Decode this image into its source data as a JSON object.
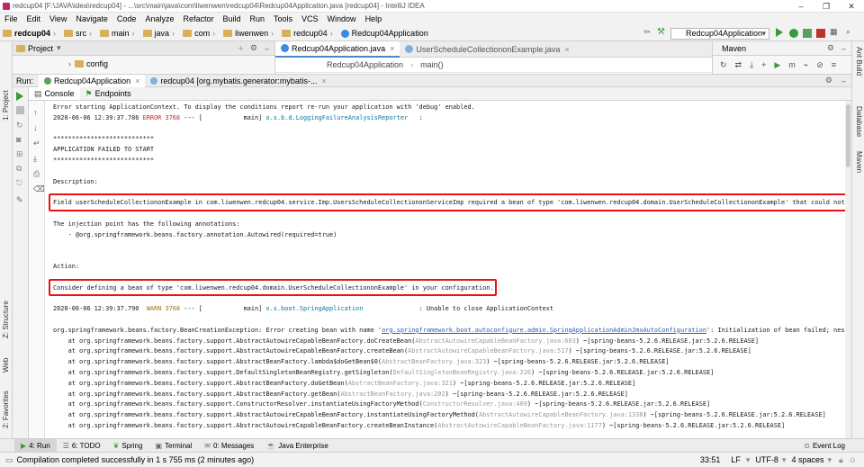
{
  "window": {
    "title": "redcup04 [F:\\JAVA\\idea\\redcup04] - ...\\src\\main\\java\\com\\liwenwen\\redcup04\\Redcup04Application.java [redcup04] - IntelliJ IDEA",
    "controls": [
      "–",
      "❐",
      "✕"
    ]
  },
  "menu": [
    "File",
    "Edit",
    "View",
    "Navigate",
    "Code",
    "Analyze",
    "Refactor",
    "Build",
    "Run",
    "Tools",
    "VCS",
    "Window",
    "Help"
  ],
  "breadcrumb": [
    "redcup04",
    "src",
    "main",
    "java",
    "com",
    "liwenwen",
    "redcup04",
    "Redcup04Application"
  ],
  "run_config": "Redcup04Application",
  "project_panel": {
    "title": "Project",
    "item": "config"
  },
  "editor_tabs": [
    {
      "label": "Redcup04Application.java",
      "active": true
    },
    {
      "label": "UserScheduleCollectiononExample.java",
      "active": false
    }
  ],
  "editor_crumbs": [
    "Redcup04Application",
    "main()"
  ],
  "maven": {
    "title": "Maven"
  },
  "run_panel": {
    "label": "Run:",
    "tabs": [
      "Redcup04Application",
      "redcup04 [org.mybatis.generator:mybatis-..."
    ],
    "subtabs": [
      "Console",
      "Endpoints"
    ]
  },
  "console_lines": [
    {
      "segs": [
        {
          "t": "Error starting ApplicationContext. To display the conditions report re-run your application with 'debug' enabled.",
          "c": ""
        }
      ]
    },
    {
      "segs": [
        {
          "t": "2020-06-06 12:39:37.786 ",
          "c": ""
        },
        {
          "t": "ERROR 3768",
          "c": "err"
        },
        {
          "t": " --- [           main] ",
          "c": ""
        },
        {
          "t": "o.s.b.d.LoggingFailureAnalysisReporter",
          "c": "cls"
        },
        {
          "t": "   :",
          "c": ""
        }
      ]
    },
    {
      "segs": [
        {
          "t": "",
          "c": ""
        }
      ]
    },
    {
      "segs": [
        {
          "t": "***************************",
          "c": ""
        }
      ]
    },
    {
      "segs": [
        {
          "t": "APPLICATION FAILED TO START",
          "c": ""
        }
      ]
    },
    {
      "segs": [
        {
          "t": "***************************",
          "c": ""
        }
      ]
    },
    {
      "segs": [
        {
          "t": "",
          "c": ""
        }
      ]
    },
    {
      "segs": [
        {
          "t": "Description:",
          "c": ""
        }
      ]
    },
    {
      "segs": [
        {
          "t": "",
          "c": ""
        }
      ]
    },
    {
      "segs": [
        {
          "t": "Field userScheduleCollectiononExample in com.liwenwen.redcup04.service.Imp.UsersScheduleCollectiononServiceImp required a bean of type 'com.liwenwen.redcup04.domain.UserScheduleCollectiononExample' that could not be found.",
          "c": ""
        }
      ]
    },
    {
      "segs": [
        {
          "t": "",
          "c": ""
        }
      ]
    },
    {
      "segs": [
        {
          "t": "The injection point has the following annotations:",
          "c": ""
        }
      ]
    },
    {
      "segs": [
        {
          "t": "    - @org.springframework.beans.factory.annotation.Autowired(required=true)",
          "c": ""
        }
      ]
    },
    {
      "segs": [
        {
          "t": "",
          "c": ""
        }
      ]
    },
    {
      "segs": [
        {
          "t": "",
          "c": ""
        }
      ]
    },
    {
      "segs": [
        {
          "t": "Action:",
          "c": ""
        }
      ]
    },
    {
      "segs": [
        {
          "t": "",
          "c": ""
        }
      ]
    },
    {
      "segs": [
        {
          "t": "Consider defining a bean of type 'com.liwenwen.redcup04.domain.UserScheduleCollectiononExample' in your configuration.",
          "c": ""
        }
      ]
    },
    {
      "segs": [
        {
          "t": "",
          "c": ""
        }
      ]
    },
    {
      "segs": [
        {
          "t": "2020-06-06 12:39:37.790  ",
          "c": ""
        },
        {
          "t": "WARN 3768",
          "c": "warn"
        },
        {
          "t": " --- [           main] ",
          "c": ""
        },
        {
          "t": "o.s.boot.SpringApplication",
          "c": "cls"
        },
        {
          "t": "               : Unable to close ApplicationContext",
          "c": ""
        }
      ]
    },
    {
      "segs": [
        {
          "t": "",
          "c": ""
        }
      ]
    },
    {
      "segs": [
        {
          "t": "org.springframework.beans.factory.BeanCreationException: Error creating bean with name '",
          "c": ""
        },
        {
          "t": "org.springframework.boot.autoconfigure.admin.SpringApplicationAdminJmxAutoConfiguration",
          "c": "lnk"
        },
        {
          "t": "': Initialization of bean failed; nested exception",
          "c": ""
        }
      ]
    },
    {
      "segs": [
        {
          "t": "    at org.springframework.beans.factory.support.AbstractAutowireCapableBeanFactory.doCreateBean(",
          "c": ""
        },
        {
          "t": "AbstractAutowireCapableBeanFactory.java:603",
          "c": "gray"
        },
        {
          "t": ") ~[spring-beans-5.2.6.RELEASE.jar:5.2.6.RELEASE]",
          "c": ""
        }
      ]
    },
    {
      "segs": [
        {
          "t": "    at org.springframework.beans.factory.support.AbstractAutowireCapableBeanFactory.createBean(",
          "c": ""
        },
        {
          "t": "AbstractAutowireCapableBeanFactory.java:517",
          "c": "gray"
        },
        {
          "t": ") ~[spring-beans-5.2.6.RELEASE.jar:5.2.6.RELEASE]",
          "c": ""
        }
      ]
    },
    {
      "segs": [
        {
          "t": "    at org.springframework.beans.factory.support.AbstractBeanFactory.lambda$doGetBean$0(",
          "c": ""
        },
        {
          "t": "AbstractBeanFactory.java:323",
          "c": "gray"
        },
        {
          "t": ") ~[spring-beans-5.2.6.RELEASE.jar:5.2.6.RELEASE]",
          "c": ""
        }
      ]
    },
    {
      "segs": [
        {
          "t": "    at org.springframework.beans.factory.support.DefaultSingletonBeanRegistry.getSingleton(",
          "c": ""
        },
        {
          "t": "DefaultSingletonBeanRegistry.java:226",
          "c": "gray"
        },
        {
          "t": ") ~[spring-beans-5.2.6.RELEASE.jar:5.2.6.RELEASE]",
          "c": ""
        }
      ]
    },
    {
      "segs": [
        {
          "t": "    at org.springframework.beans.factory.support.AbstractBeanFactory.doGetBean(",
          "c": ""
        },
        {
          "t": "AbstractBeanFactory.java:321",
          "c": "gray"
        },
        {
          "t": ") ~[spring-beans-5.2.6.RELEASE.jar:5.2.6.RELEASE]",
          "c": ""
        }
      ]
    },
    {
      "segs": [
        {
          "t": "    at org.springframework.beans.factory.support.AbstractBeanFactory.getBean(",
          "c": ""
        },
        {
          "t": "AbstractBeanFactory.java:202",
          "c": "gray"
        },
        {
          "t": ") ~[spring-beans-5.2.6.RELEASE.jar:5.2.6.RELEASE]",
          "c": ""
        }
      ]
    },
    {
      "segs": [
        {
          "t": "    at org.springframework.beans.factory.support.ConstructorResolver.instantiateUsingFactoryMethod(",
          "c": ""
        },
        {
          "t": "ConstructorResolver.java:409",
          "c": "gray"
        },
        {
          "t": ") ~[spring-beans-5.2.6.RELEASE.jar:5.2.6.RELEASE]",
          "c": ""
        }
      ]
    },
    {
      "segs": [
        {
          "t": "    at org.springframework.beans.factory.support.AbstractAutowireCapableBeanFactory.instantiateUsingFactoryMethod(",
          "c": ""
        },
        {
          "t": "AbstractAutowireCapableBeanFactory.java:1338",
          "c": "gray"
        },
        {
          "t": ") ~[spring-beans-5.2.6.RELEASE.jar:5.2.6.RELEASE]",
          "c": ""
        }
      ]
    },
    {
      "segs": [
        {
          "t": "    at org.springframework.beans.factory.support.AbstractAutowireCapableBeanFactory.createBeanInstance(",
          "c": ""
        },
        {
          "t": "AbstractAutowireCapableBeanFactory.java:1177",
          "c": "gray"
        },
        {
          "t": ") ~[spring-beans-5.2.6.RELEASE.jar:5.2.6.RELEASE]",
          "c": ""
        }
      ]
    }
  ],
  "bottom_tabs": [
    {
      "label": "4: Run",
      "active": true
    },
    {
      "label": "6: TODO",
      "active": false
    },
    {
      "label": "Spring",
      "active": false
    },
    {
      "label": "Terminal",
      "active": false
    },
    {
      "label": "0: Messages",
      "active": false
    },
    {
      "label": "Java Enterprise",
      "active": false
    }
  ],
  "event_log": "Event Log",
  "status": {
    "message": "Compilation completed successfully in 1 s 755 ms (2 minutes ago)",
    "position": "33:51",
    "line_sep": "LF",
    "encoding": "UTF-8",
    "indent": "4 spaces"
  },
  "side_labels": {
    "left_top": "1: Project",
    "left_structure": "Z: Structure",
    "left_web": "Web",
    "left_favorites": "2: Favorites",
    "right_ant": "Ant Build",
    "right_database": "Database",
    "right_maven": "Maven"
  },
  "colors": {
    "accent": "#4a88c7",
    "error": "#d12424",
    "highlight_box": "#ee1111"
  }
}
